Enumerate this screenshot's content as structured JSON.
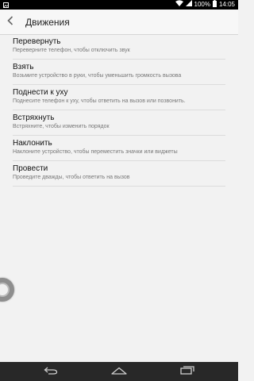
{
  "status_bar": {
    "battery_percent": "100%",
    "time": "14:05",
    "icons": [
      "image-icon",
      "wifi-icon",
      "signal-icon",
      "battery-icon"
    ]
  },
  "action_bar": {
    "title": "Движения",
    "back_icon": "chevron-left-icon"
  },
  "items": [
    {
      "title": "Перевернуть",
      "subtitle": "Переверните телефон, чтобы отключить звук"
    },
    {
      "title": "Взять",
      "subtitle": "Возьмите устройство в руки, чтобы уменьшить громкость вызова"
    },
    {
      "title": "Поднести к уху",
      "subtitle": "Поднесите телефон к уху, чтобы ответить на вызов или позвонить."
    },
    {
      "title": "Встряхнуть",
      "subtitle": "Встряхните, чтобы изменить порядок"
    },
    {
      "title": "Наклонить",
      "subtitle": "Наклоните устройство, чтобы переместить значки или виджеты"
    },
    {
      "title": "Провести",
      "subtitle": "Проведите дважды, чтобы ответить на вызов"
    }
  ],
  "nav_bar": {
    "buttons": [
      "back-icon",
      "home-icon",
      "recent-apps-icon"
    ]
  },
  "colors": {
    "background": "#f2f2f2",
    "status_bar": "#000000",
    "nav_bar": "#282828",
    "divider": "#dcdcdc"
  }
}
